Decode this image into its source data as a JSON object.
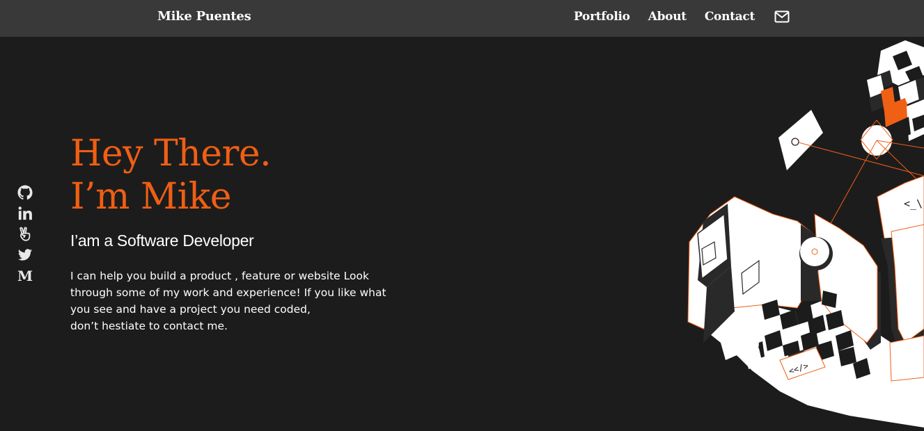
{
  "nav": {
    "brand": "Mike Puentes",
    "links": [
      "Portfolio",
      "About",
      "Contact"
    ],
    "mail_icon": "mail-icon"
  },
  "socials": [
    {
      "name": "github",
      "icon": "github-icon"
    },
    {
      "name": "linkedin",
      "icon": "linkedin-icon"
    },
    {
      "name": "angellist",
      "icon": "angellist-icon"
    },
    {
      "name": "twitter",
      "icon": "twitter-icon"
    },
    {
      "name": "medium",
      "icon": "medium-icon"
    }
  ],
  "hero": {
    "title_line1": "Hey There.",
    "title_line2": "I’m Mike",
    "subtitle": "I’am a Software Developer",
    "text_lines": [
      "I can help you build a product , feature or website Look",
      "through some of my work and experience! If you like what",
      "you see and have a project you need coded,",
      "don’t hestiate to contact me."
    ]
  },
  "illustration": {
    "code_tag_1": "<_\\",
    "code_tag_2": "<</>"
  },
  "colors": {
    "background": "#1d1c1c",
    "navbar": "#3a393a",
    "accent": "#ef5f14",
    "text": "#ffffff"
  }
}
